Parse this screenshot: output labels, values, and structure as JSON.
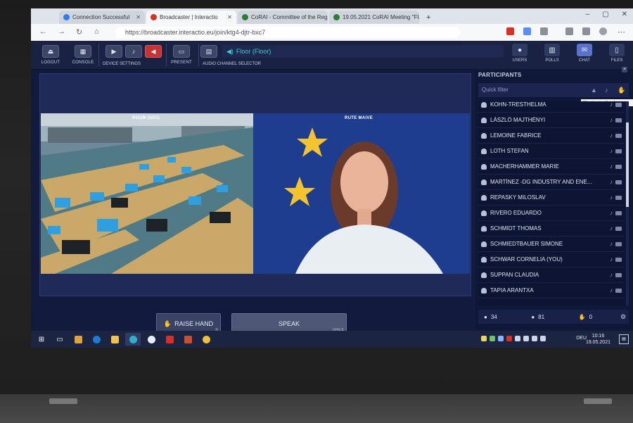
{
  "browser": {
    "tabs": [
      {
        "label": "Connection Successful",
        "favicon_color": "#2b7de9"
      },
      {
        "label": "Broadcaster | Interactio",
        "favicon_color": "#d93025"
      },
      {
        "label": "CoRAI - Committee of the Regio",
        "favicon_color": "#2e7d32"
      },
      {
        "label": "19.05.2021 CoRAI Meeting \"FUS",
        "favicon_color": "#2e7d32"
      }
    ],
    "new_tab": "+",
    "url": "https://broadcaster.interactio.eu/join/ktg4-djtr-bxc7"
  },
  "toolbar": {
    "logout": "LOGOUT",
    "console": "CONSOLE",
    "device_settings": "DEVICE SETTINGS",
    "present": "PRESENT",
    "audio_channel_selector": "AUDIO CHANNEL SELECTOR",
    "channel": "Floor (Floor)",
    "users": "USERS",
    "polls": "POLLS",
    "chat": "CHAT",
    "files": "FILES"
  },
  "stage": {
    "room_label": "ROOM (DE5)",
    "speaker_label": "RUTE MAIVE"
  },
  "actions": {
    "raise_hand": "RAISE HAND",
    "raise_hand_key": "R",
    "speak": "SPEAK",
    "speak_key": "SPACE"
  },
  "participants": {
    "title": "PARTICIPANTS",
    "filter_placeholder": "Quick filter",
    "tooltip": "Filter by raised hands",
    "list": [
      "KOHN-TRESTHELMA",
      "LÁSZLÓ MAJTHÉNYI",
      "LEMOINE FABRICE",
      "LOTH STEFAN",
      "MACHERHAMMER MARIE",
      "MARTÍNEZ -DG INDUSTRY AND ENE...",
      "REPASKY MILOSLAV",
      "RIVERO EDUARDO",
      "SCHMIDT THOMAS",
      "SCHMIEDTBAUER SIMONE",
      "SCHWAR CORNELIA (YOU)",
      "SUPPAN CLAUDIA",
      "TAPIA ARANTXA"
    ],
    "count_speakers": "34",
    "count_listeners": "81",
    "count_hands": "0"
  },
  "taskbar": {
    "language": "DEU",
    "time": "10:16",
    "date": "19.05.2021"
  }
}
